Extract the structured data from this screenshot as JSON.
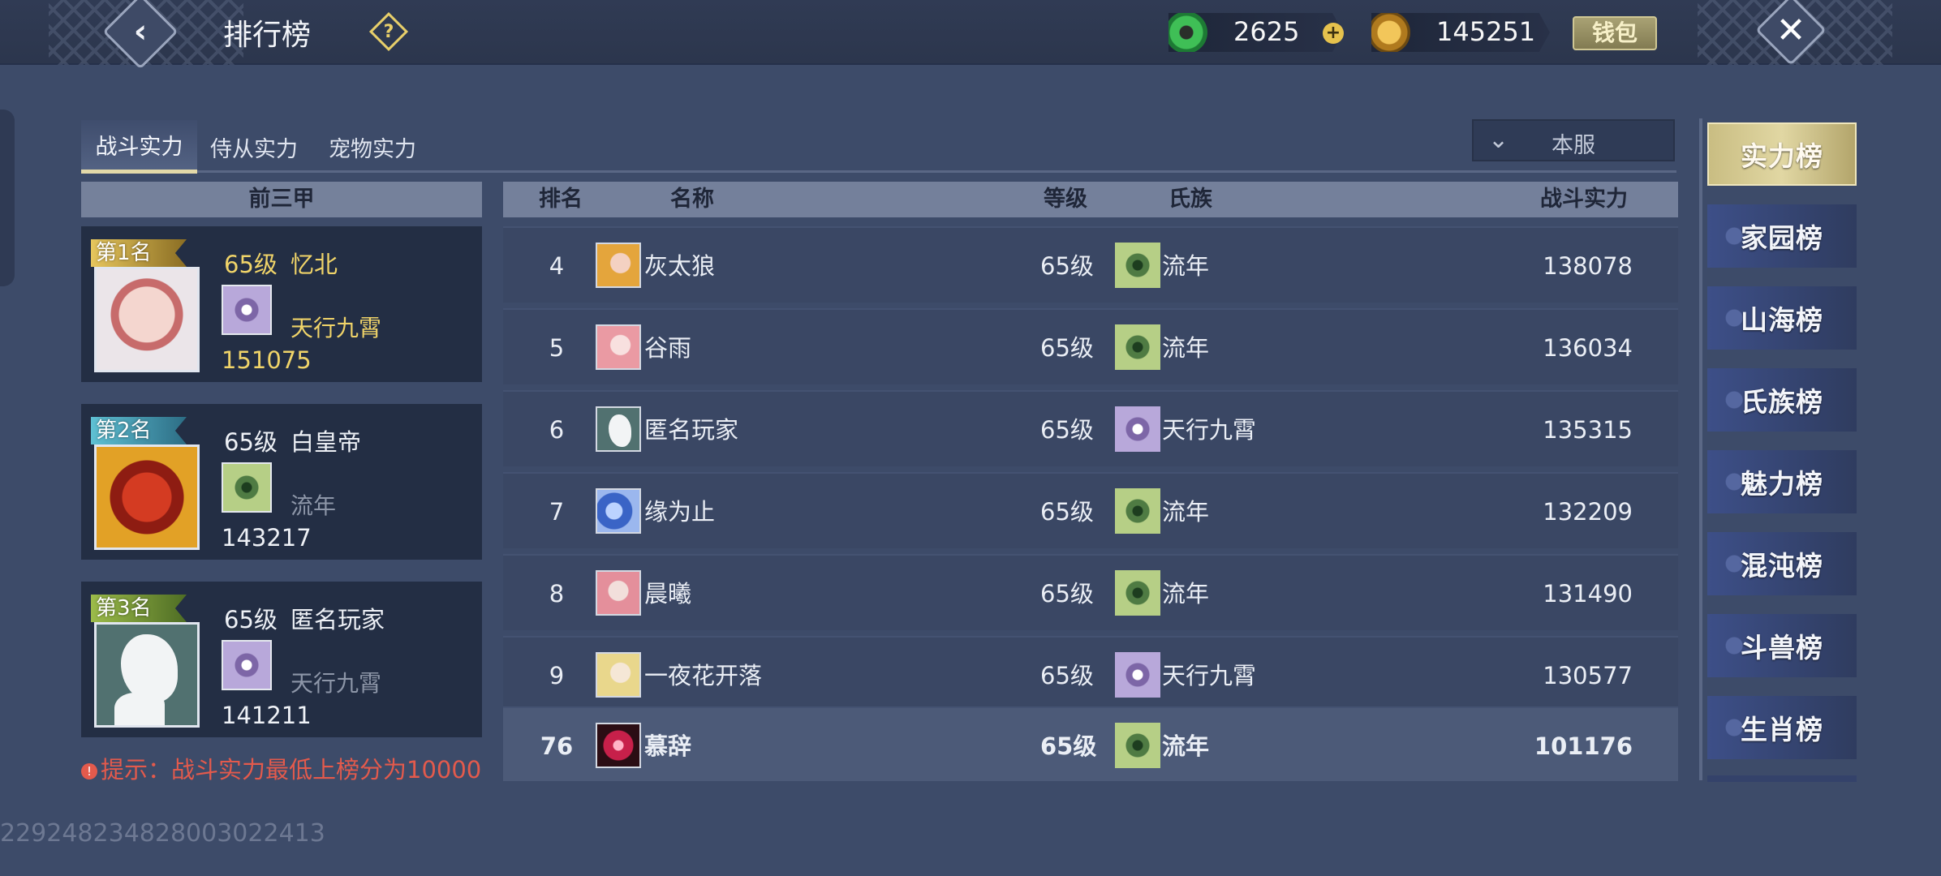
{
  "header": {
    "title": "排行榜",
    "jade_amount": "2625",
    "coin_amount": "145251",
    "wallet_label": "钱包"
  },
  "tabs": [
    {
      "label": "战斗实力",
      "active": true
    },
    {
      "label": "侍从实力",
      "active": false
    },
    {
      "label": "宠物实力",
      "active": false
    }
  ],
  "server_filter": {
    "value": "本服"
  },
  "top3": {
    "header": "前三甲",
    "cards": [
      {
        "rank_label": "第1名",
        "level": "65级",
        "name": "忆北",
        "clan": "天行九霄",
        "power": "151075"
      },
      {
        "rank_label": "第2名",
        "level": "65级",
        "name": "白皇帝",
        "clan": "流年",
        "power": "143217"
      },
      {
        "rank_label": "第3名",
        "level": "65级",
        "name": "匿名玩家",
        "clan": "天行九霄",
        "power": "141211"
      }
    ]
  },
  "table": {
    "columns": {
      "rank": "排名",
      "name": "名称",
      "level": "等级",
      "clan": "氏族",
      "power": "战斗实力"
    },
    "rows": [
      {
        "rank": "4",
        "name": "灰太狼",
        "level": "65级",
        "clan": "流年",
        "power": "138078"
      },
      {
        "rank": "5",
        "name": "谷雨",
        "level": "65级",
        "clan": "流年",
        "power": "136034"
      },
      {
        "rank": "6",
        "name": "匿名玩家",
        "level": "65级",
        "clan": "天行九霄",
        "power": "135315"
      },
      {
        "rank": "7",
        "name": "缘为止",
        "level": "65级",
        "clan": "流年",
        "power": "132209"
      },
      {
        "rank": "8",
        "name": "晨曦",
        "level": "65级",
        "clan": "流年",
        "power": "131490"
      },
      {
        "rank": "9",
        "name": "一夜花开落",
        "level": "65级",
        "clan": "天行九霄",
        "power": "130577"
      }
    ],
    "my_row": {
      "rank": "76",
      "name": "慕辞",
      "level": "65级",
      "clan": "流年",
      "power": "101176"
    }
  },
  "hint": "提示：战斗实力最低上榜分为10000",
  "uid": "229248234828003022413",
  "nav": [
    {
      "label": "实力榜",
      "active": true
    },
    {
      "label": "家园榜",
      "active": false
    },
    {
      "label": "山海榜",
      "active": false
    },
    {
      "label": "氏族榜",
      "active": false
    },
    {
      "label": "魅力榜",
      "active": false
    },
    {
      "label": "混沌榜",
      "active": false
    },
    {
      "label": "斗兽榜",
      "active": false
    },
    {
      "label": "生肖榜",
      "active": false
    }
  ],
  "icons": {
    "back": "back-chevron-icon",
    "help": "question-diamond-icon",
    "jade": "jade-currency-icon",
    "coin": "gold-coin-icon",
    "close": "close-x-icon",
    "clan_purple": "purple-swirl-clan-icon",
    "clan_green": "green-ram-clan-icon"
  },
  "colors": {
    "gold_text": "#f0d469",
    "hint_red": "#e35a4c",
    "nav_active": "#e1d7a3"
  }
}
